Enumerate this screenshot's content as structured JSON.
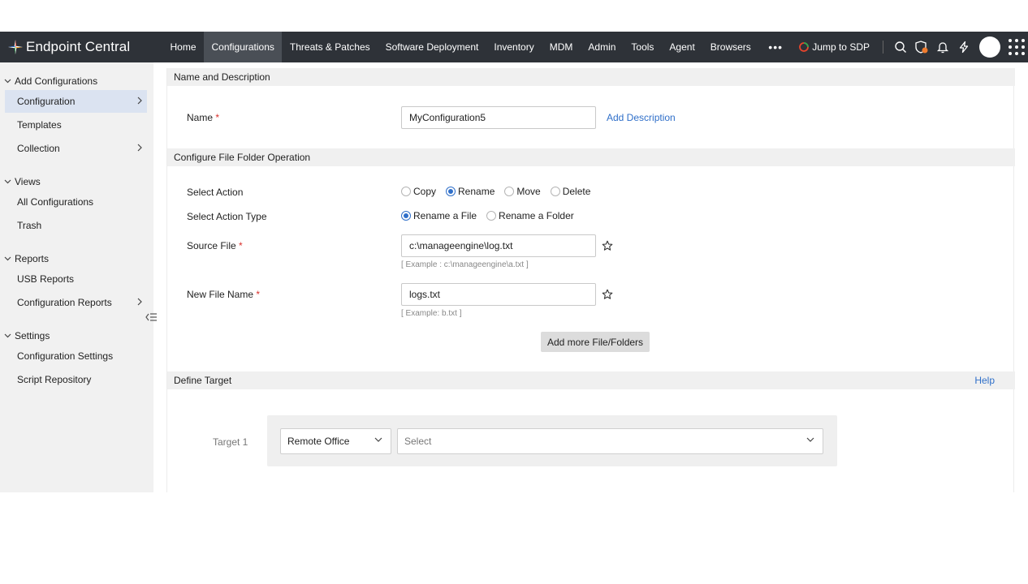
{
  "brand": {
    "name": "Endpoint Central"
  },
  "nav": {
    "items": [
      {
        "label": "Home"
      },
      {
        "label": "Configurations"
      },
      {
        "label": "Threats & Patches"
      },
      {
        "label": "Software Deployment"
      },
      {
        "label": "Inventory"
      },
      {
        "label": "MDM"
      },
      {
        "label": "Admin"
      },
      {
        "label": "Tools"
      },
      {
        "label": "Agent"
      },
      {
        "label": "Browsers"
      }
    ],
    "active": "Configurations",
    "more": "•••",
    "jump_label": "Jump to SDP"
  },
  "sidebar": {
    "sections": [
      {
        "title": "Add Configurations",
        "items": [
          {
            "label": "Configuration"
          },
          {
            "label": "Templates"
          },
          {
            "label": "Collection"
          }
        ]
      },
      {
        "title": "Views",
        "items": [
          {
            "label": "All Configurations"
          },
          {
            "label": "Trash"
          }
        ]
      },
      {
        "title": "Reports",
        "items": [
          {
            "label": "USB Reports"
          },
          {
            "label": "Configuration Reports"
          }
        ]
      },
      {
        "title": "Settings",
        "items": [
          {
            "label": "Configuration Settings"
          },
          {
            "label": "Script Repository"
          }
        ]
      }
    ]
  },
  "form": {
    "section1": "Name and Description",
    "name_label": "Name",
    "required_mark": "*",
    "name_value": "MyConfiguration5",
    "add_description": "Add Description",
    "section2": "Configure File Folder Operation",
    "select_action_label": "Select Action",
    "actions": [
      {
        "label": "Copy"
      },
      {
        "label": "Rename"
      },
      {
        "label": "Move"
      },
      {
        "label": "Delete"
      }
    ],
    "selected_action": "Rename",
    "select_action_type_label": "Select Action Type",
    "action_types": [
      {
        "label": "Rename a File"
      },
      {
        "label": "Rename a Folder"
      }
    ],
    "selected_action_type": "Rename a File",
    "source_file_label": "Source File",
    "source_file_value": "c:\\manageengine\\log.txt",
    "source_file_hint": "[ Example : c:\\manageengine\\a.txt ]",
    "new_file_label": "New File Name",
    "new_file_value": "logs.txt",
    "new_file_hint": "[ Example: b.txt ]",
    "add_more": "Add more File/Folders",
    "section3": "Define Target",
    "help": "Help",
    "target_label": "Target 1",
    "target_type": "Remote Office",
    "target_select_placeholder": "Select"
  },
  "colors": {
    "nav_bg": "#2e3238",
    "accent": "#2f6fc9",
    "sidebar_active": "#dbe3f1",
    "required": "#d9302c"
  }
}
